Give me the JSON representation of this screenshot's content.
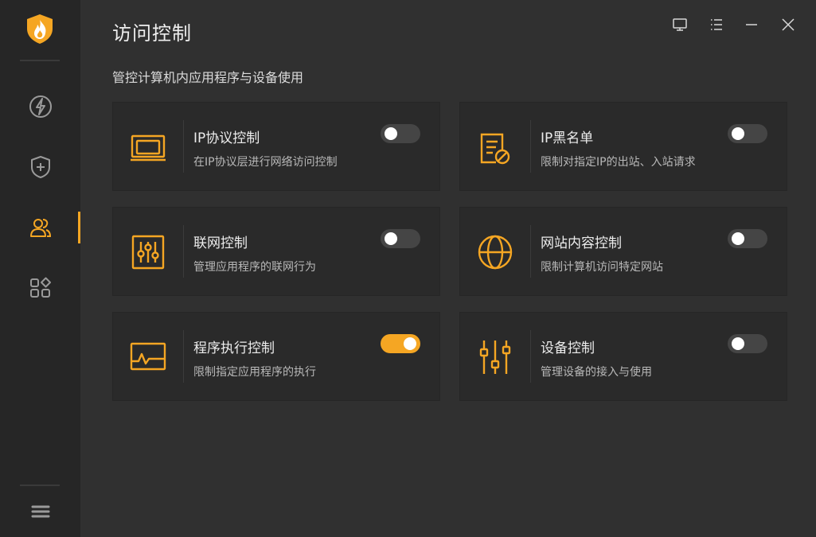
{
  "window": {
    "title": "访问控制",
    "subtitle": "管控计算机内应用程序与设备使用",
    "controls": [
      "screen-icon",
      "menu-list-icon",
      "minimize-icon",
      "close-icon"
    ]
  },
  "sidebar": {
    "logo": "flame-shield-logo",
    "items": [
      {
        "name": "speedup",
        "icon": "lightning-icon",
        "active": false
      },
      {
        "name": "protection",
        "icon": "shield-plus-icon",
        "active": false
      },
      {
        "name": "access-control",
        "icon": "users-icon",
        "active": true
      },
      {
        "name": "toolbox",
        "icon": "apps-icon",
        "active": false
      }
    ],
    "bottom_icon": "hamburger-menu-icon"
  },
  "colors": {
    "accent": "#f5a623",
    "background": "#303030",
    "sidebar": "#262626",
    "card": "#2a2a2a"
  },
  "cards": [
    {
      "title": "IP协议控制",
      "desc": "在IP协议层进行网络访问控制",
      "icon": "laptop-icon",
      "enabled": false
    },
    {
      "title": "IP黑名单",
      "desc": "限制对指定IP的出站、入站请求",
      "icon": "document-block-icon",
      "enabled": false
    },
    {
      "title": "联网控制",
      "desc": "管理应用程序的联网行为",
      "icon": "sliders-box-icon",
      "enabled": false
    },
    {
      "title": "网站内容控制",
      "desc": "限制计算机访问特定网站",
      "icon": "globe-icon",
      "enabled": false
    },
    {
      "title": "程序执行控制",
      "desc": "限制指定应用程序的执行",
      "icon": "activity-window-icon",
      "enabled": true
    },
    {
      "title": "设备控制",
      "desc": "管理设备的接入与使用",
      "icon": "equalizer-icon",
      "enabled": false
    }
  ]
}
